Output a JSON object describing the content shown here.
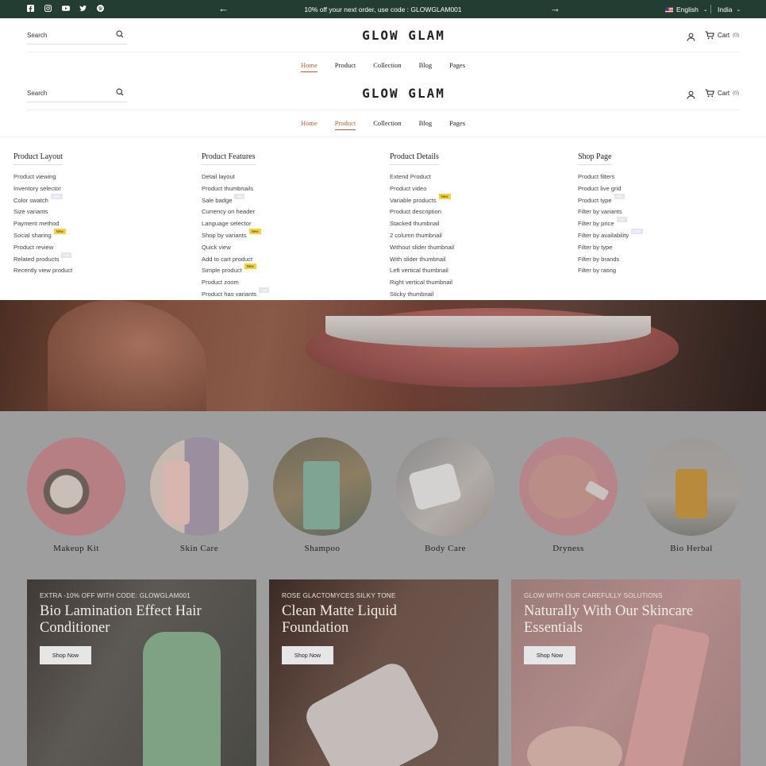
{
  "announcement": {
    "text": "10% off your next order, use code : GLOWGLAM001",
    "language": "English",
    "country": "India",
    "socials": [
      "facebook-icon",
      "instagram-icon",
      "youtube-icon",
      "twitter-icon",
      "pinterest-icon"
    ]
  },
  "header": {
    "search_label": "Search",
    "logo": "GLOW GLAM",
    "cart_label": "Cart",
    "cart_count": "(0)",
    "nav": [
      "Home",
      "Product",
      "Collection",
      "Blog",
      "Pages"
    ]
  },
  "mega_menu": {
    "columns": [
      {
        "heading": "Product Layout",
        "items": [
          {
            "label": "Product viewing",
            "badge": ""
          },
          {
            "label": "Inventory selector",
            "badge": ""
          },
          {
            "label": "Color swatch",
            "badge": "Sale"
          },
          {
            "label": "Size variants",
            "badge": ""
          },
          {
            "label": "Payment method",
            "badge": ""
          },
          {
            "label": "Social sharing",
            "badge": "New"
          },
          {
            "label": "Product review",
            "badge": ""
          },
          {
            "label": "Related products",
            "badge": "Hot"
          },
          {
            "label": "Recently view product",
            "badge": ""
          }
        ]
      },
      {
        "heading": "Product Features",
        "items": [
          {
            "label": "Detail layout",
            "badge": ""
          },
          {
            "label": "Product thumbnails",
            "badge": ""
          },
          {
            "label": "Sale badge",
            "badge": "Hot"
          },
          {
            "label": "Currency on header",
            "badge": ""
          },
          {
            "label": "Language selector",
            "badge": ""
          },
          {
            "label": "Shop by variants",
            "badge": "New"
          },
          {
            "label": "Quick view",
            "badge": ""
          },
          {
            "label": "Add to cart product",
            "badge": ""
          },
          {
            "label": "Simple product",
            "badge": "New"
          },
          {
            "label": "Product zoom",
            "badge": ""
          },
          {
            "label": "Product has variants",
            "badge": "Hot"
          }
        ]
      },
      {
        "heading": "Product Details",
        "items": [
          {
            "label": "Extend Product",
            "badge": ""
          },
          {
            "label": "Product video",
            "badge": ""
          },
          {
            "label": "Variable products",
            "badge": "New"
          },
          {
            "label": "Product description",
            "badge": ""
          },
          {
            "label": "Stacked thumbnail",
            "badge": ""
          },
          {
            "label": "2 column thumbnail",
            "badge": ""
          },
          {
            "label": "Without slider thumbnail",
            "badge": ""
          },
          {
            "label": "With slider thumbnail",
            "badge": ""
          },
          {
            "label": "Left vertical thumbnail",
            "badge": ""
          },
          {
            "label": "Right vertical thumbnail",
            "badge": ""
          },
          {
            "label": "Sticky thumbnail",
            "badge": ""
          }
        ]
      },
      {
        "heading": "Shop Page",
        "items": [
          {
            "label": "Product filters",
            "badge": ""
          },
          {
            "label": "Product live grid",
            "badge": ""
          },
          {
            "label": "Product type",
            "badge": "Hot"
          },
          {
            "label": "Filter by variants",
            "badge": ""
          },
          {
            "label": "Filter by price",
            "badge": "Hot"
          },
          {
            "label": "Filter by availability",
            "badge": "Sale"
          },
          {
            "label": "Filter by type",
            "badge": ""
          },
          {
            "label": "Filter by brands",
            "badge": ""
          },
          {
            "label": "Filter by rating",
            "badge": ""
          }
        ]
      }
    ]
  },
  "categories": [
    "Makeup Kit",
    "Skin Care",
    "Shampoo",
    "Body Care",
    "Dryness",
    "Bio Herbal"
  ],
  "promos": [
    {
      "tag": "EXTRA -10% OFF WITH CODE: GLOWGLAM001",
      "title": "Bio Lamination Effect Hair Conditioner",
      "button": "Shop Now"
    },
    {
      "tag": "ROSE GLACTOMYCES SILKY TONE",
      "title": "Clean Matte Liquid Foundation",
      "button": "Shop Now"
    },
    {
      "tag": "GLOW WITH OUR CAREFULLY SOLUTIONS",
      "title": "Naturally With Our Skincare Essentials",
      "button": "Shop Now"
    }
  ],
  "colors": {
    "topbar": "#243d33",
    "accent": "#c05c3a",
    "badge_new": "#f7d13b"
  }
}
